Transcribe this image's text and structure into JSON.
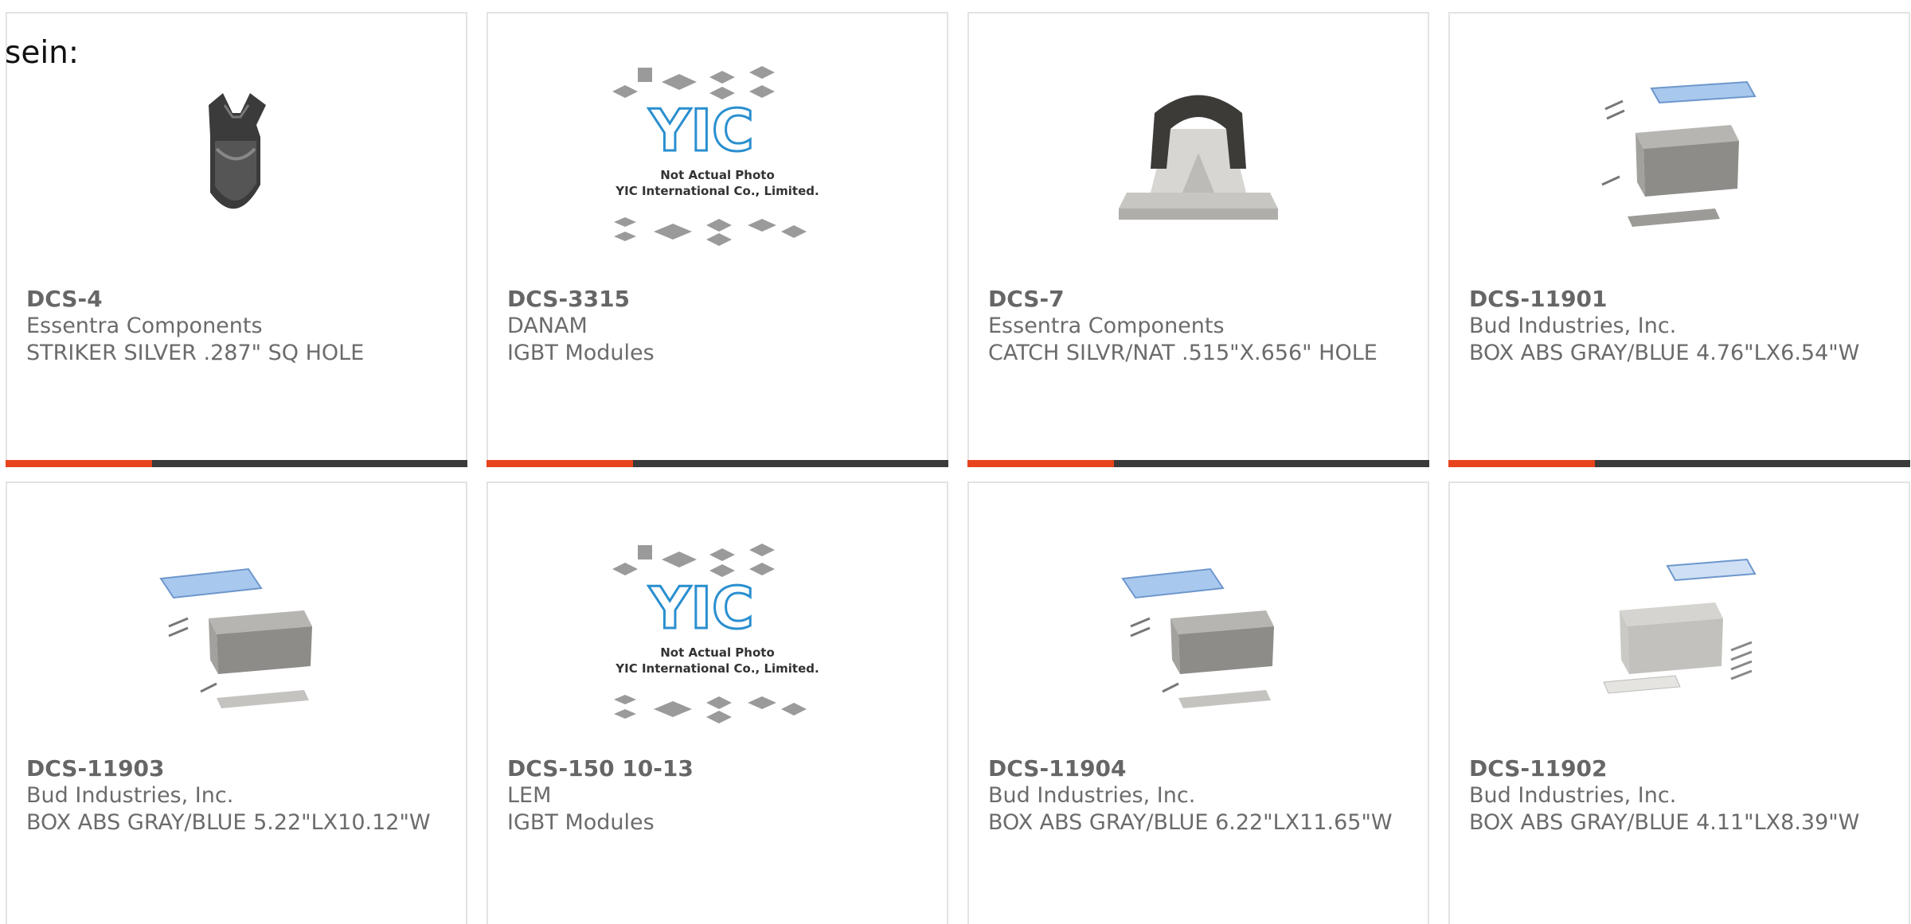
{
  "page": {
    "label": "sein:"
  },
  "colors": {
    "accent": "#e8441c",
    "bar": "#3a3a3a",
    "border": "#e3e3e3",
    "text": "#6b6b6b"
  },
  "products": [
    {
      "part": "DCS-4",
      "maker": "Essentra Components",
      "desc": "STRIKER SILVER .287\" SQ HOLE",
      "image": "striker-clip-icon"
    },
    {
      "part": "DCS-3315",
      "maker": "DANAM",
      "desc": "IGBT Modules",
      "image": "yic-placeholder-icon",
      "placeholder_lines": [
        "Not Actual Photo",
        "YIC International Co., Limited."
      ],
      "placeholder_logo": "YIC"
    },
    {
      "part": "DCS-7",
      "maker": "Essentra Components",
      "desc": "CATCH SILVR/NAT .515\"X.656\" HOLE",
      "image": "catch-icon"
    },
    {
      "part": "DCS-11901",
      "maker": "Bud Industries, Inc.",
      "desc": "BOX ABS GRAY/BLUE 4.76\"LX6.54\"W",
      "image": "enclosure-box-icon"
    },
    {
      "part": "DCS-11903",
      "maker": "Bud Industries, Inc.",
      "desc": "BOX ABS GRAY/BLUE 5.22\"LX10.12\"W",
      "image": "enclosure-box-icon"
    },
    {
      "part": "DCS-150 10-13",
      "maker": "LEM",
      "desc": "IGBT Modules",
      "image": "yic-placeholder-icon",
      "placeholder_lines": [
        "Not Actual Photo",
        "YIC International Co., Limited."
      ],
      "placeholder_logo": "YIC"
    },
    {
      "part": "DCS-11904",
      "maker": "Bud Industries, Inc.",
      "desc": "BOX ABS GRAY/BLUE 6.22\"LX11.65\"W",
      "image": "enclosure-box-icon"
    },
    {
      "part": "DCS-11902",
      "maker": "Bud Industries, Inc.",
      "desc": "BOX ABS GRAY/BLUE 4.11\"LX8.39\"W",
      "image": "enclosure-box-icon"
    }
  ]
}
